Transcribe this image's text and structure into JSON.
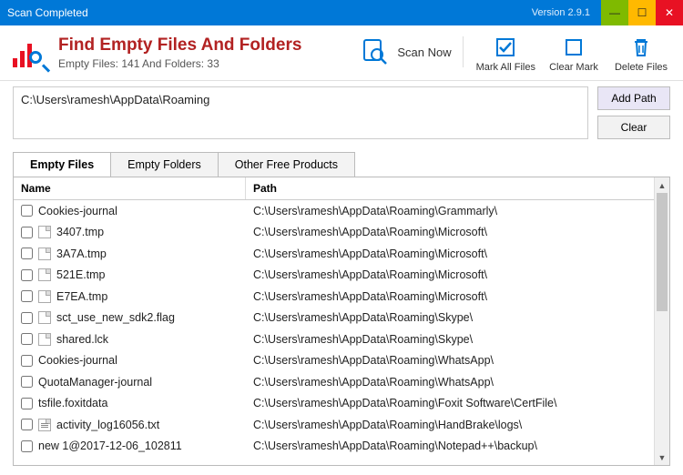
{
  "window": {
    "title": "Scan Completed",
    "version": "Version 2.9.1"
  },
  "app": {
    "title": "Find Empty Files And Folders",
    "subtitle": "Empty Files: 141 And Folders: 33"
  },
  "actions": {
    "scan": "Scan Now",
    "markall": "Mark All Files",
    "clearmark": "Clear Mark",
    "delete": "Delete Files"
  },
  "path": {
    "value": "C:\\Users\\ramesh\\AppData\\Roaming",
    "add": "Add Path",
    "clear": "Clear"
  },
  "tabs": {
    "t1": "Empty Files",
    "t2": "Empty Folders",
    "t3": "Other Free Products"
  },
  "cols": {
    "name": "Name",
    "path": "Path"
  },
  "rows": [
    {
      "name": "Cookies-journal",
      "icon": "none",
      "path": "C:\\Users\\ramesh\\AppData\\Roaming\\Grammarly\\"
    },
    {
      "name": "3407.tmp",
      "icon": "file",
      "path": "C:\\Users\\ramesh\\AppData\\Roaming\\Microsoft\\"
    },
    {
      "name": "3A7A.tmp",
      "icon": "file",
      "path": "C:\\Users\\ramesh\\AppData\\Roaming\\Microsoft\\"
    },
    {
      "name": "521E.tmp",
      "icon": "file",
      "path": "C:\\Users\\ramesh\\AppData\\Roaming\\Microsoft\\"
    },
    {
      "name": "E7EA.tmp",
      "icon": "file",
      "path": "C:\\Users\\ramesh\\AppData\\Roaming\\Microsoft\\"
    },
    {
      "name": "sct_use_new_sdk2.flag",
      "icon": "file",
      "path": "C:\\Users\\ramesh\\AppData\\Roaming\\Skype\\"
    },
    {
      "name": "shared.lck",
      "icon": "file",
      "path": "C:\\Users\\ramesh\\AppData\\Roaming\\Skype\\"
    },
    {
      "name": "Cookies-journal",
      "icon": "none",
      "path": "C:\\Users\\ramesh\\AppData\\Roaming\\WhatsApp\\"
    },
    {
      "name": "QuotaManager-journal",
      "icon": "none",
      "path": "C:\\Users\\ramesh\\AppData\\Roaming\\WhatsApp\\"
    },
    {
      "name": "tsfile.foxitdata",
      "icon": "none",
      "path": "C:\\Users\\ramesh\\AppData\\Roaming\\Foxit Software\\CertFile\\"
    },
    {
      "name": "activity_log16056.txt",
      "icon": "txt",
      "path": "C:\\Users\\ramesh\\AppData\\Roaming\\HandBrake\\logs\\"
    },
    {
      "name": "new 1@2017-12-06_102811",
      "icon": "none",
      "path": "C:\\Users\\ramesh\\AppData\\Roaming\\Notepad++\\backup\\"
    }
  ]
}
